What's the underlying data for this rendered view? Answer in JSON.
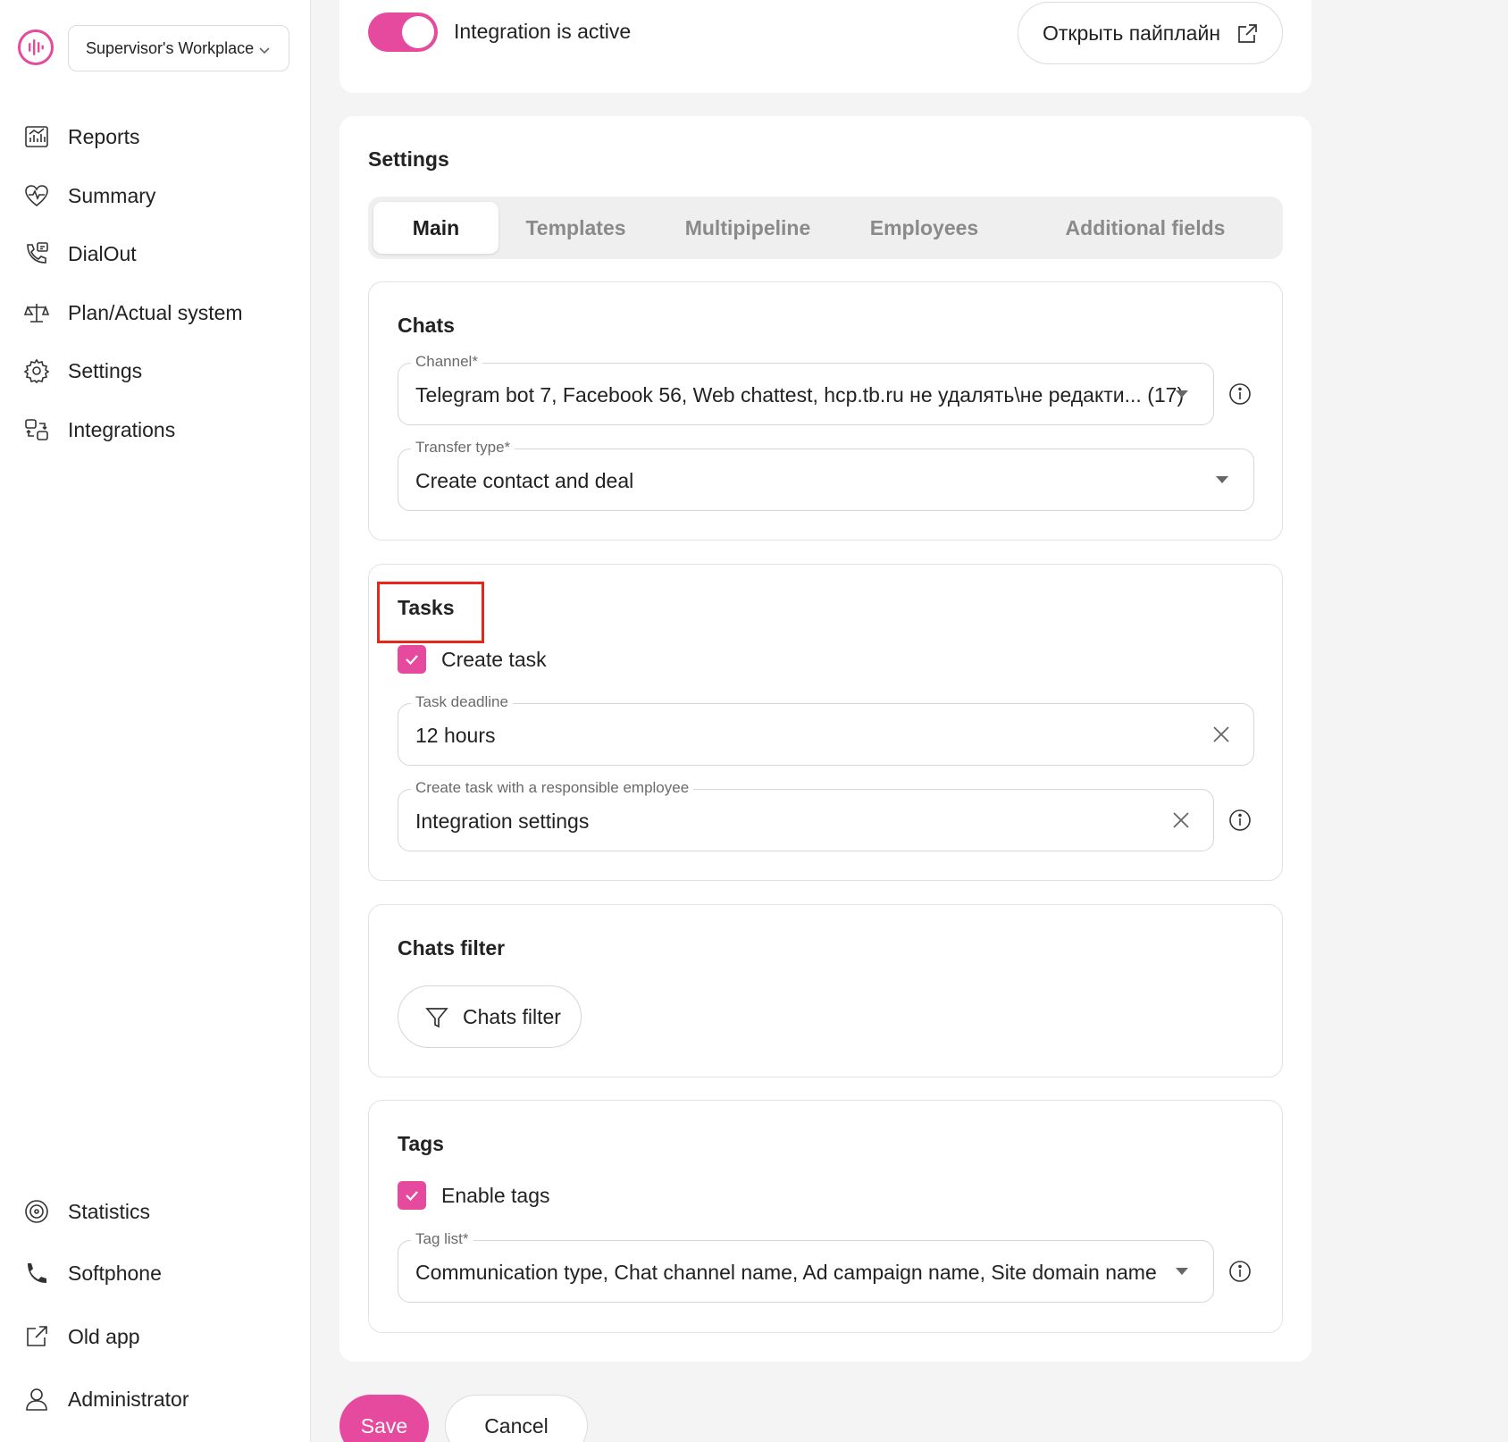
{
  "sidebar": {
    "workspace": "Supervisor's Workplace",
    "nav_top": [
      {
        "label": "Reports",
        "icon": "chart-icon"
      },
      {
        "label": "Summary",
        "icon": "heart-pulse-icon"
      },
      {
        "label": "DialOut",
        "icon": "phone-outgoing-icon"
      },
      {
        "label": "Plan/Actual system",
        "icon": "scales-icon"
      },
      {
        "label": "Settings",
        "icon": "gear-icon"
      },
      {
        "label": "Integrations",
        "icon": "integration-icon"
      }
    ],
    "nav_bottom": [
      {
        "label": "Statistics",
        "icon": "stats-icon"
      },
      {
        "label": "Softphone",
        "icon": "phone-icon"
      },
      {
        "label": "Old app",
        "icon": "external-link-icon"
      },
      {
        "label": "Administrator",
        "icon": "user-icon"
      }
    ]
  },
  "top": {
    "toggle_label": "Integration is active",
    "toggle_on": true,
    "open_pipeline": "Открыть пайплайн"
  },
  "settings": {
    "title": "Settings",
    "tabs": [
      "Main",
      "Templates",
      "Multipipeline",
      "Employees",
      "Additional fields"
    ],
    "active_tab": "Main"
  },
  "chats": {
    "title": "Chats",
    "channel_label": "Channel*",
    "channel_value": "Telegram bot 7, Facebook 56, Web chattest, hcp.tb.ru не удалять\\не редакти... (17)",
    "transfer_label": "Transfer type*",
    "transfer_value": "Create contact and deal"
  },
  "tasks": {
    "title": "Tasks",
    "create_task_label": "Create task",
    "create_task_checked": true,
    "deadline_label": "Task deadline",
    "deadline_value": "12 hours",
    "responsible_label": "Create task with a responsible employee",
    "responsible_value": "Integration settings"
  },
  "chats_filter": {
    "title": "Chats filter",
    "button_label": "Chats filter"
  },
  "tags": {
    "title": "Tags",
    "enable_label": "Enable tags",
    "enable_checked": true,
    "list_label": "Tag list*",
    "list_value": "Communication type, Chat channel name, Ad campaign name, Site domain name"
  },
  "footer": {
    "save": "Save",
    "cancel": "Cancel"
  },
  "colors": {
    "accent": "#e64a9f",
    "highlight": "#e8271b"
  }
}
